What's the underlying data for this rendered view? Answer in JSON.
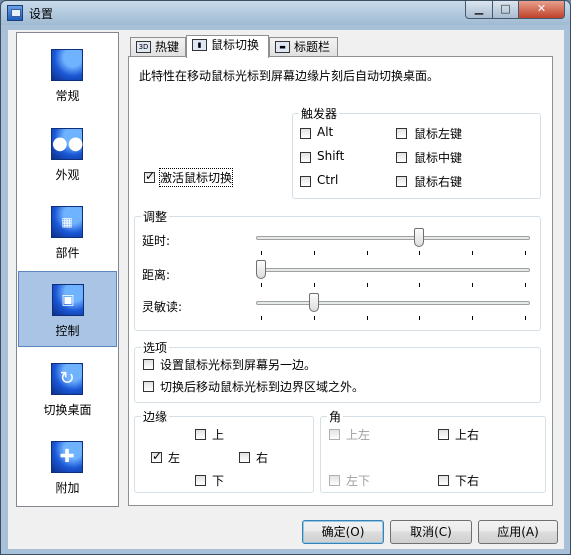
{
  "window": {
    "title": "设置"
  },
  "sidebar": {
    "items": [
      {
        "label": "常规",
        "icon": "general-icon"
      },
      {
        "label": "外观",
        "icon": "appearance-icon"
      },
      {
        "label": "部件",
        "icon": "widgets-icon"
      },
      {
        "label": "控制",
        "icon": "control-icon",
        "selected": true
      },
      {
        "label": "切换桌面",
        "icon": "switch-desktop-icon"
      },
      {
        "label": "附加",
        "icon": "addon-icon"
      }
    ]
  },
  "tabs": [
    {
      "label": "热键",
      "icon": "hotkey-icon"
    },
    {
      "label": "鼠标切换",
      "icon": "mouse-switch-icon",
      "active": true
    },
    {
      "label": "标题栏",
      "icon": "titlebar-icon"
    }
  ],
  "mouse_switch": {
    "description": "此特性在移动鼠标光标到屏幕边缘片刻后自动切换桌面。",
    "activate": {
      "label": "激活鼠标切换",
      "checked": true
    },
    "trigger": {
      "title": "触发器",
      "alt": "Alt",
      "shift": "Shift",
      "ctrl": "Ctrl",
      "left": "鼠标左键",
      "middle": "鼠标中键",
      "right": "鼠标右键"
    },
    "adjust": {
      "title": "调整",
      "delay": {
        "label": "延时:",
        "value": 0.6
      },
      "distance": {
        "label": "距离:",
        "value": 0.0
      },
      "sensitivity": {
        "label": "灵敏读:",
        "value": 0.2
      }
    },
    "options": {
      "title": "选项",
      "opt1": "设置鼠标光标到屏幕另一边。",
      "opt2": "切换后移动鼠标光标到边界区域之外。"
    },
    "edges": {
      "title": "边缘",
      "top": "上",
      "left": "左",
      "right": "右",
      "bottom": "下",
      "left_checked": true
    },
    "corners": {
      "title": "角",
      "top_left": "上左",
      "top_right": "上右",
      "bottom_left": "左下",
      "bottom_right": "下右"
    }
  },
  "buttons": {
    "ok": "确定(O)",
    "cancel": "取消(C)",
    "apply": "应用(A)"
  }
}
